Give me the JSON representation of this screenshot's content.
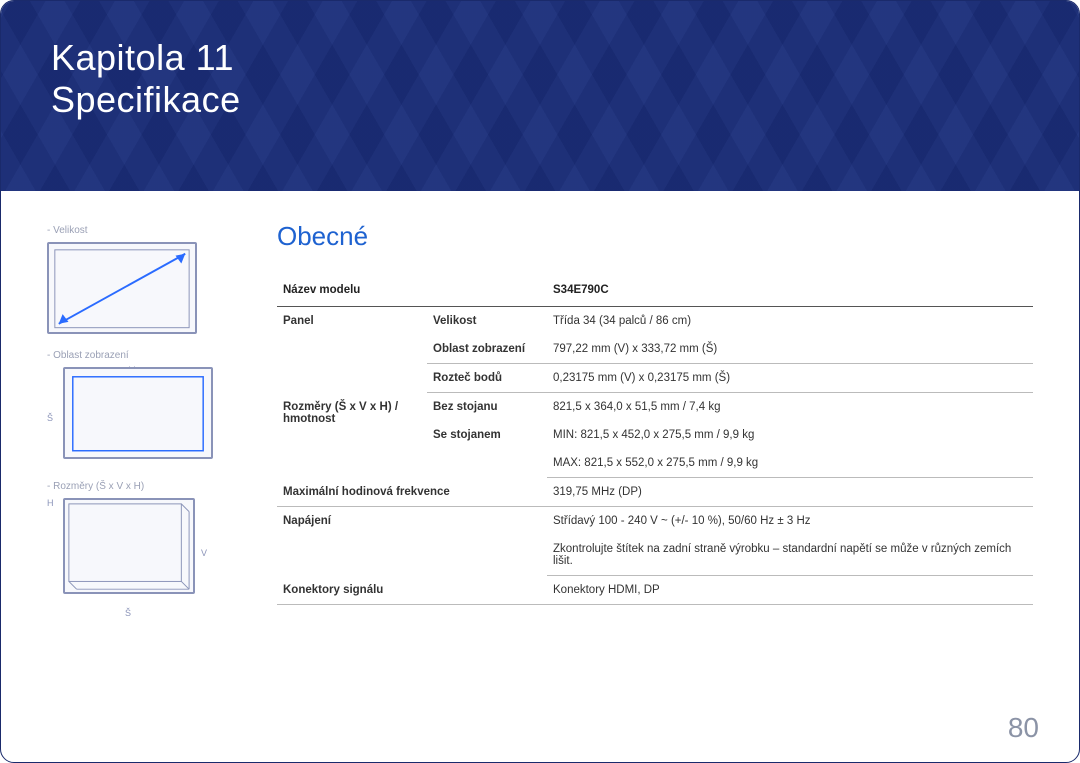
{
  "hero": {
    "chapter": "Kapitola 11",
    "title": "Specifikace"
  },
  "side": {
    "label_size": "Velikost",
    "label_display_area": "Oblast zobrazení",
    "label_dimensions": "Rozměry (Š x V x H)",
    "dim_V": "V",
    "dim_S": "Š",
    "dim_H": "H"
  },
  "section_title": "Obecné",
  "spec_header": {
    "model_name_label": "Název modelu",
    "model_name_value": "S34E790C"
  },
  "rows": {
    "panel": "Panel",
    "panel_size_label": "Velikost",
    "panel_size_value": "Třída 34 (34 palců / 86 cm)",
    "display_area_label": "Oblast zobrazení",
    "display_area_value": "797,22 mm (V) x 333,72 mm (Š)",
    "pixel_pitch_label": "Rozteč bodů",
    "pixel_pitch_value": "0,23175 mm (V) x 0,23175 mm (Š)",
    "dimensions": "Rozměry (Š x V x H) / hmotnost",
    "without_stand_label": "Bez stojanu",
    "without_stand_value": "821,5 x 364,0 x 51,5 mm / 7,4 kg",
    "with_stand_label": "Se stojanem",
    "with_stand_value_min": "MIN: 821,5 x 452,0 x 275,5 mm / 9,9 kg",
    "with_stand_value_max": "MAX: 821,5 x 552,0 x 275,5 mm / 9,9 kg",
    "max_clock_label": "Maximální hodinová frekvence",
    "max_clock_value": "319,75 MHz (DP)",
    "power_label": "Napájení",
    "power_value1": "Střídavý 100 - 240 V ~ (+/- 10 %), 50/60 Hz ± 3 Hz",
    "power_value2": "Zkontrolujte štítek na zadní straně výrobku – standardní napětí se může v různých zemích lišit.",
    "signal_label": "Konektory signálu",
    "signal_value": "Konektory HDMI, DP"
  },
  "page_number": "80"
}
